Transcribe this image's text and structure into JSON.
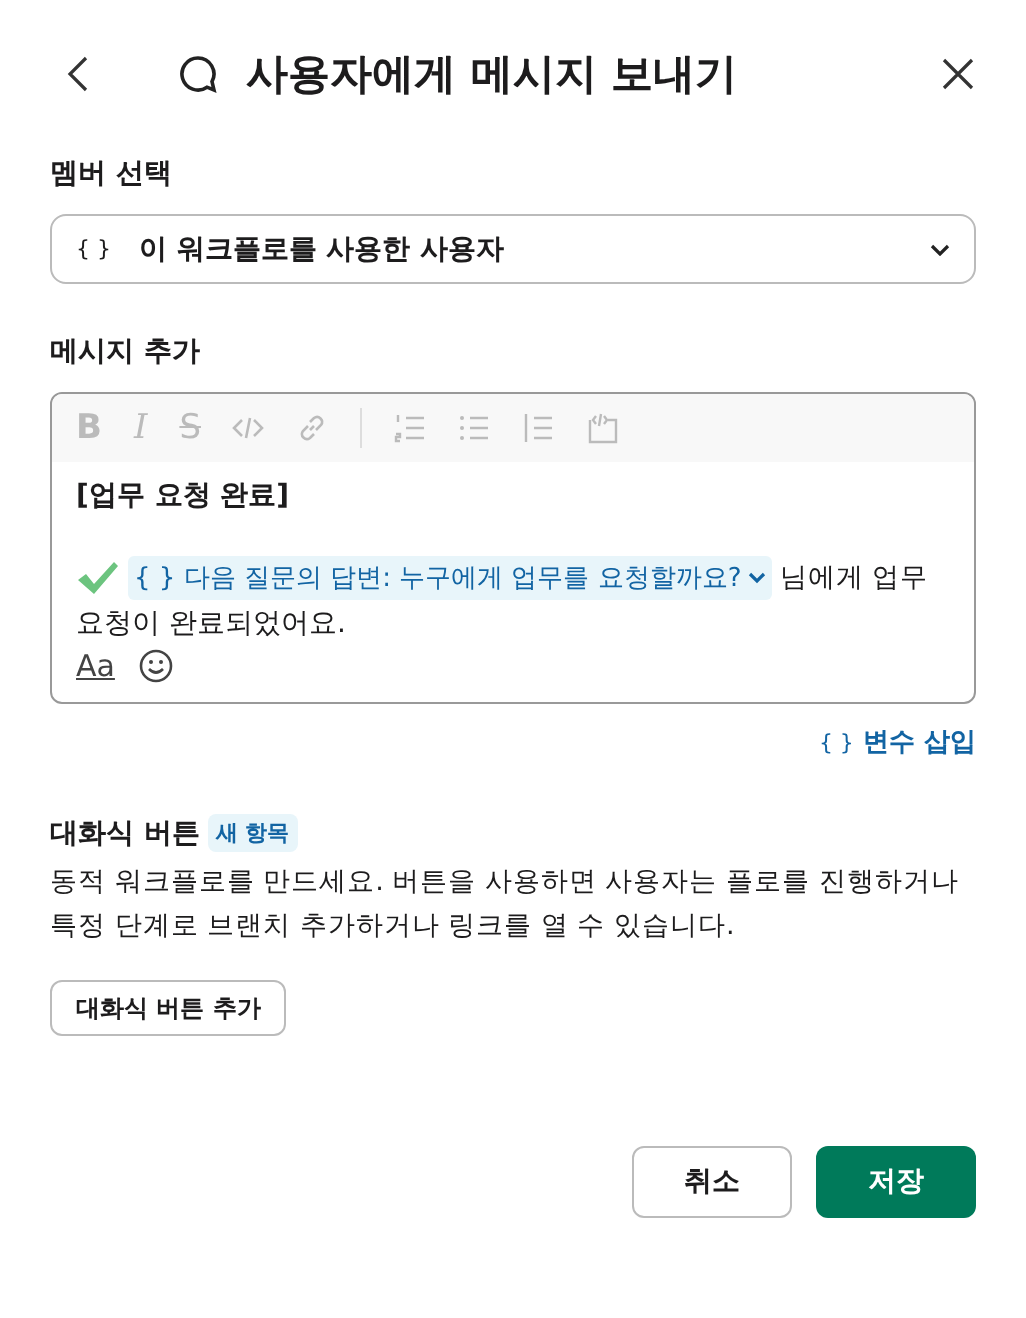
{
  "header": {
    "title": "사용자에게 메시지 보내기"
  },
  "member": {
    "label": "멤버 선택",
    "brace": "{ }",
    "value": "이 워크플로를 사용한 사용자"
  },
  "message": {
    "label": "메시지 추가",
    "toolbar": [
      {
        "kind": "bold",
        "label": "B"
      },
      {
        "kind": "italic",
        "label": "I"
      },
      {
        "kind": "strike",
        "label": "S"
      },
      {
        "kind": "code"
      },
      {
        "kind": "link"
      },
      {
        "kind": "divider"
      },
      {
        "kind": "ordered"
      },
      {
        "kind": "bullet"
      },
      {
        "kind": "quote"
      },
      {
        "kind": "codeblock"
      }
    ],
    "heading": "[업무 요청 완료]",
    "variable": "{ } 다음 질문의 답변: 누구에게 업무를 요청할까요?",
    "text": "님에게 업무",
    "text_next": "요청이 완료되었어요.",
    "format": "Aa"
  },
  "insert_variable": {
    "brace": "{ }",
    "label": "변수 삽입"
  },
  "interactive": {
    "title": "대화식 버튼",
    "badge": "새 항목",
    "description": "동적 워크플로를 만드세요. 버튼을 사용하면 사용자는 플로를 진행하거나 특정 단계로 브랜치 추가하거나 링크를 열 수 있습니다.",
    "button": "대화식 버튼 추가"
  },
  "footer": {
    "cancel": "취소",
    "save": "저장"
  }
}
